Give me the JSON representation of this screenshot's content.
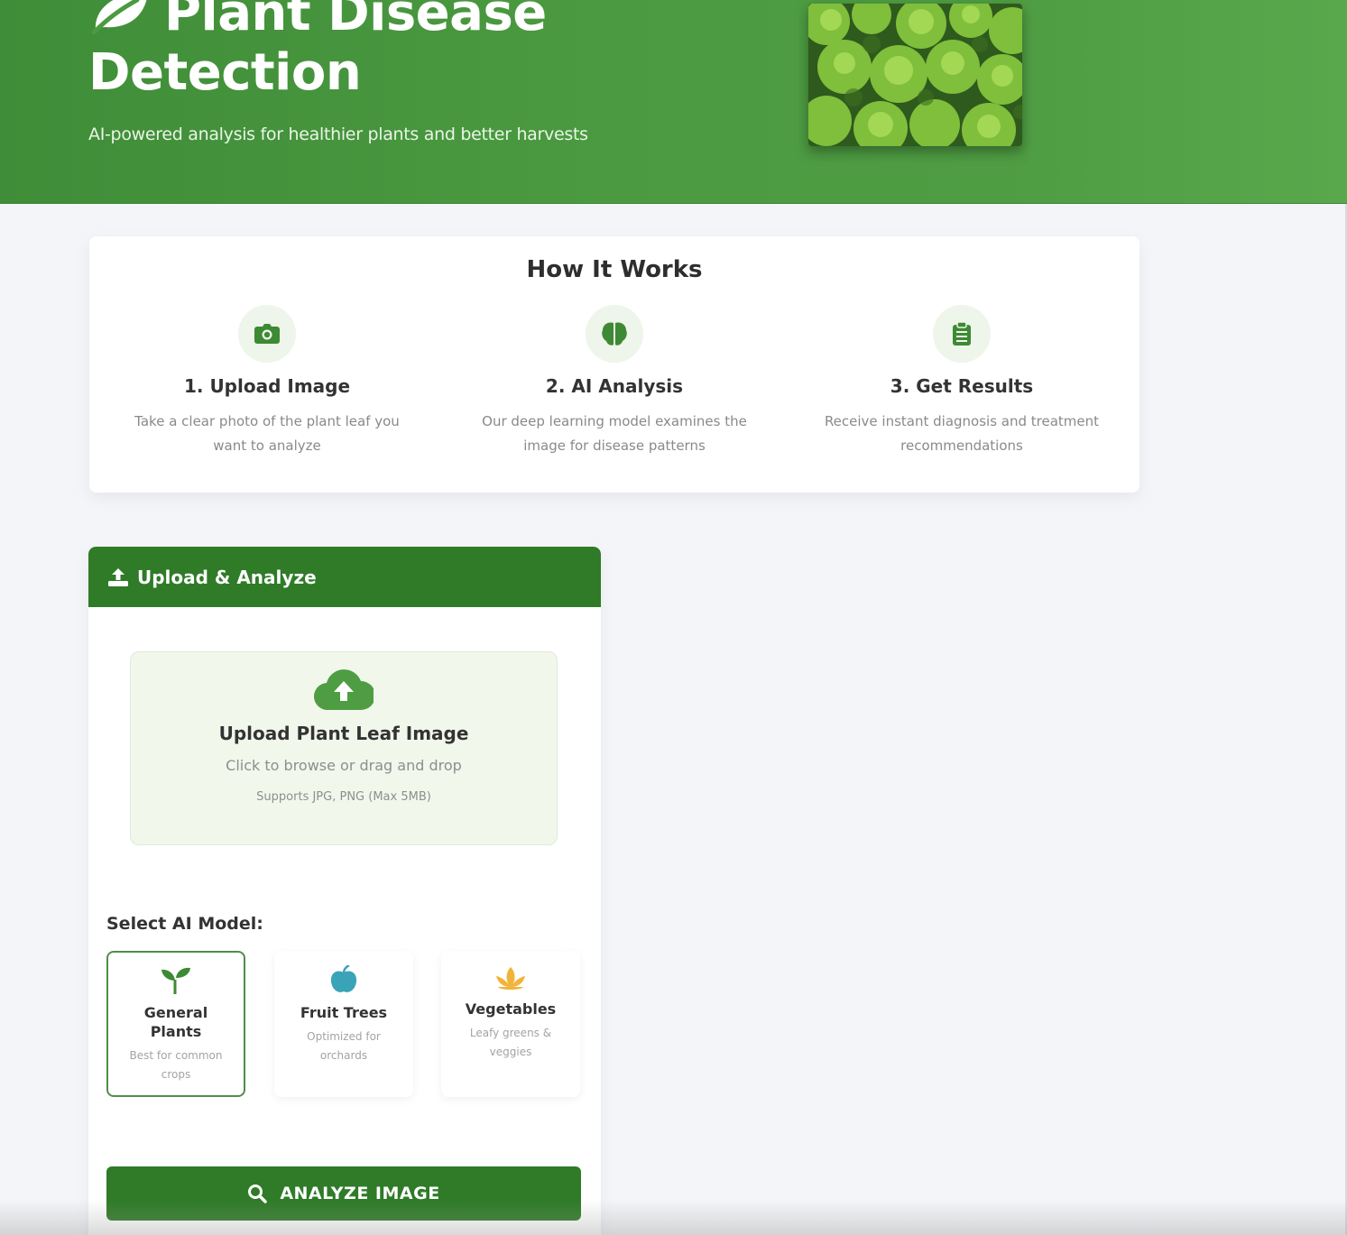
{
  "hero": {
    "title": "Plant Disease Detection",
    "subtitle": "AI-powered analysis for healthier plants and better harvests",
    "icons": {
      "logo": "leaf-icon",
      "photo": "lettuce-photo"
    }
  },
  "how_it_works": {
    "title": "How It Works",
    "steps": [
      {
        "title": "1. Upload Image",
        "desc": "Take a clear photo of the plant leaf you want to analyze",
        "icon": "camera-icon"
      },
      {
        "title": "2. AI Analysis",
        "desc": "Our deep learning model examines the image for disease patterns",
        "icon": "brain-icon"
      },
      {
        "title": "3. Get Results",
        "desc": "Receive instant diagnosis and treatment recommendations",
        "icon": "clipboard-icon"
      }
    ]
  },
  "upload": {
    "header": "Upload & Analyze",
    "header_icon": "upload-icon",
    "dropzone": {
      "title": "Upload Plant Leaf Image",
      "subtitle": "Click to browse or drag and drop",
      "note": "Supports JPG, PNG (Max 5MB)",
      "icon": "cloud-upload-icon"
    },
    "model_label": "Select AI Model:",
    "models": [
      {
        "name": "General Plants",
        "desc": "Best for common crops",
        "icon": "seedling-icon",
        "selected": true
      },
      {
        "name": "Fruit Trees",
        "desc": "Optimized for orchards",
        "icon": "apple-icon",
        "selected": false
      },
      {
        "name": "Vegetables",
        "desc": "Leafy greens & veggies",
        "icon": "lotus-icon",
        "selected": false
      }
    ],
    "analyze_button": "ANALYZE IMAGE",
    "analyze_icon": "search-icon"
  },
  "colors": {
    "brand_green": "#2f7b28",
    "hero_green": "#4b9a41",
    "icon_green": "#3d8a34",
    "apple_blue": "#3aa3b8",
    "lotus_yellow": "#f1b43a"
  }
}
